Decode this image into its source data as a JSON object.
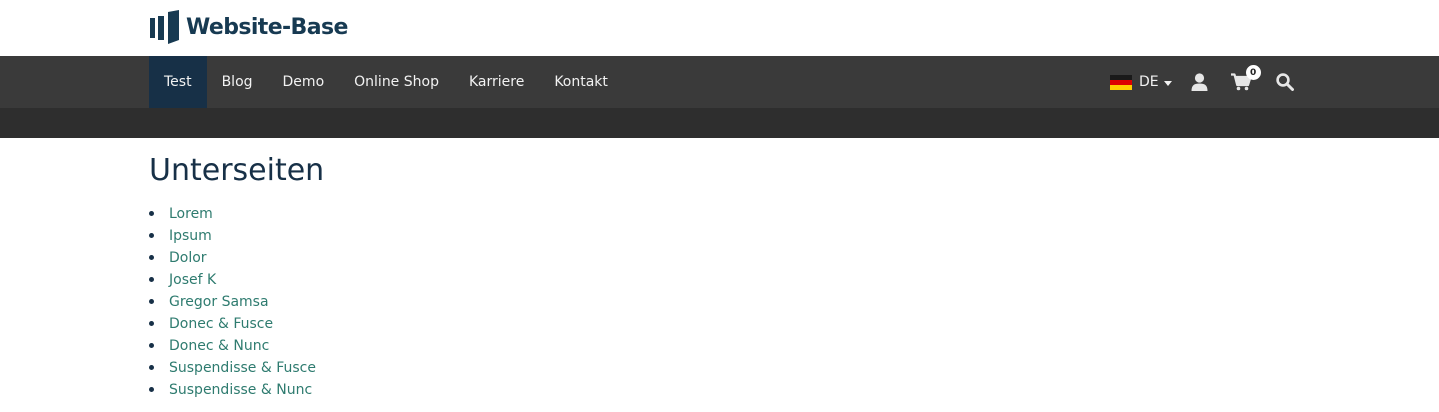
{
  "brand": {
    "name": "Website-Base",
    "color": "#173a52"
  },
  "nav": {
    "items": [
      {
        "label": "Test",
        "active": true
      },
      {
        "label": "Blog"
      },
      {
        "label": "Demo"
      },
      {
        "label": "Online Shop"
      },
      {
        "label": "Karriere"
      },
      {
        "label": "Kontakt"
      }
    ]
  },
  "tools": {
    "language": "DE",
    "language_flag": "flag-de",
    "account_icon": "user-icon",
    "cart_icon": "cart-icon",
    "cart_count": "0",
    "search_icon": "search-icon"
  },
  "main": {
    "title": "Unterseiten",
    "subpages": [
      "Lorem",
      "Ipsum",
      "Dolor",
      "Josef K",
      "Gregor Samsa",
      "Donec & Fusce",
      "Donec & Nunc",
      "Suspendisse & Fusce",
      "Suspendisse & Nunc"
    ]
  },
  "colors": {
    "navbar": "#3a3a3a",
    "subbar": "#2e2e2e",
    "active_nav": "#173047",
    "link": "#2e7b6f",
    "heading": "#173047"
  }
}
